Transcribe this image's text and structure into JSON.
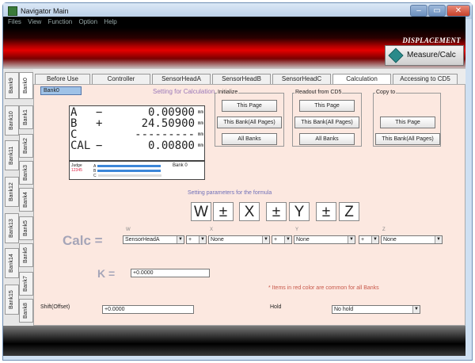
{
  "window": {
    "title": "Navigator Main",
    "controls": {
      "minimize": "–",
      "maximize": "▭",
      "close": "✕"
    }
  },
  "menu": [
    "Files",
    "View",
    "Function",
    "Option",
    "Help"
  ],
  "banner": {
    "label": "DISPLACEMENT",
    "button": "Measure/Calc"
  },
  "bank_tabs": [
    "Bank9",
    "Bank0",
    "Bank10",
    "Bank1",
    "Bank11",
    "Bank2",
    "Bank3",
    "Bank12",
    "Bank4",
    "Bank13",
    "Bank5",
    "Bank14",
    "Bank6",
    "Bank7",
    "Bank15",
    "Bank8"
  ],
  "top_tabs": [
    "Before Use",
    "Controller",
    "SensorHeadA",
    "SensorHeadB",
    "SensorHeadC",
    "Calculation",
    "Accessing to CD5"
  ],
  "active_tab": "Calculation",
  "panel": {
    "bank": "Bank0",
    "heading": "Setting for Calculation",
    "lcd": {
      "rows": [
        {
          "label": "A",
          "sign": "−",
          "value": "0.00900",
          "unit": "mm"
        },
        {
          "label": "B",
          "sign": "+",
          "value": "24.50900",
          "unit": "mm"
        },
        {
          "label": "C",
          "sign": "",
          "value": "---------",
          "unit": "mm"
        },
        {
          "label": "CAL",
          "sign": "−",
          "value": "0.00800",
          "unit": "mm"
        }
      ],
      "judge": "Judge",
      "judge_digits": "12345",
      "bank_readout": "Bank 0",
      "bar_labels": [
        "A",
        "B",
        "C"
      ]
    },
    "initialize": {
      "title": "Initialize",
      "buttons": [
        "This Page",
        "This Bank(All Pages)",
        "All Banks"
      ]
    },
    "readout": {
      "title": "Readout from CD5",
      "buttons": [
        "This Page",
        "This Bank(All Pages)",
        "All Banks"
      ]
    },
    "copyto": {
      "title": "Copy to",
      "buttons": [
        "This Page",
        "This Bank(All Pages)"
      ]
    },
    "formula_title": "Setting parameters for the formula",
    "formula": [
      "W",
      "±",
      "X",
      "±",
      "Y",
      "±",
      "Z"
    ],
    "calc_label": "Calc =",
    "calc_letters": [
      "W",
      "X",
      "Y",
      "Z"
    ],
    "calc_fields": [
      {
        "value": "SensorHeadA"
      },
      {
        "value": "+"
      },
      {
        "value": "None"
      },
      {
        "value": "+"
      },
      {
        "value": "None"
      },
      {
        "value": "+"
      },
      {
        "value": "None"
      }
    ],
    "k_label": "K =",
    "k_value": "+0.0000",
    "note": "* Items in red color are common for all Banks",
    "shift_label": "Shift(Offset)",
    "shift_value": "+0.0000",
    "hold_label": "Hold",
    "hold_value": "No hold"
  },
  "colors": {
    "banner_red": "#e40000",
    "panel_bg": "#fce8e0",
    "heading": "#9a78b8",
    "note": "#c8584a",
    "bar_blue": "#3c86d8"
  }
}
